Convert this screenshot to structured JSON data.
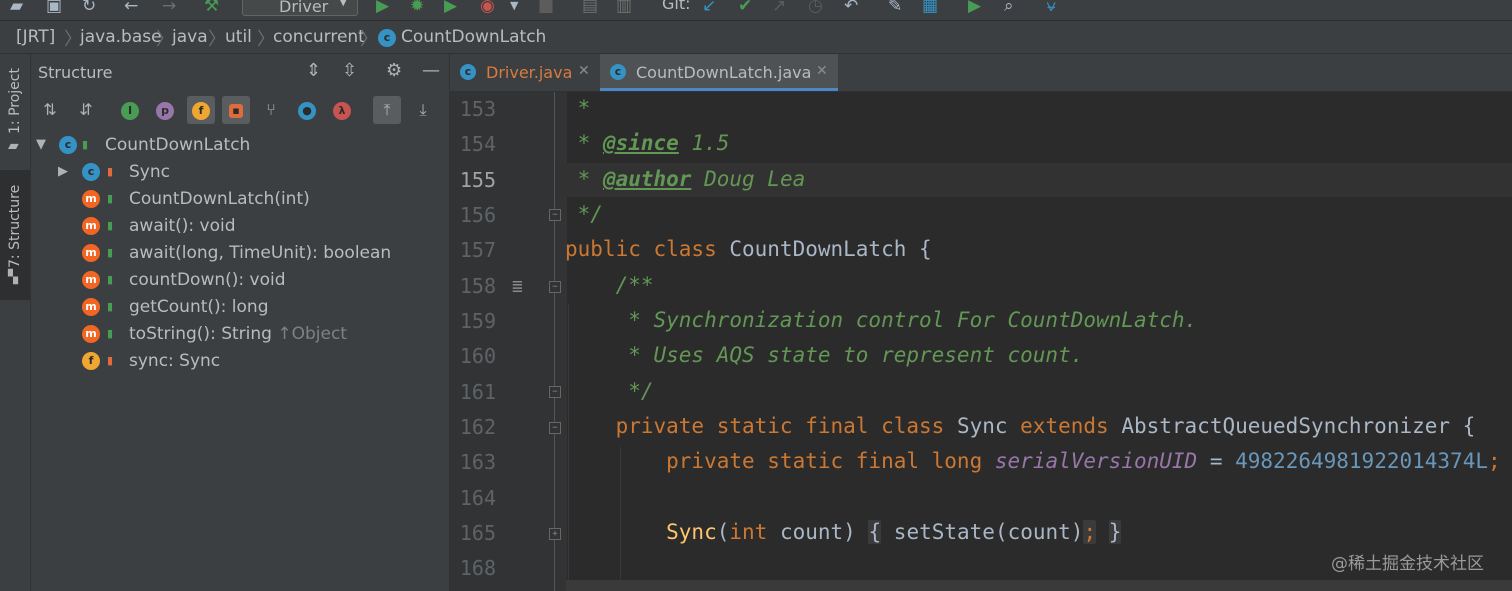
{
  "toolbar": {
    "run_config": "Driver",
    "git_label": "Git:"
  },
  "breadcrumb": [
    "[JRT]",
    "java.base",
    "java",
    "util",
    "concurrent",
    "CountDownLatch"
  ],
  "left_stripe": {
    "project": "1: Project",
    "structure": "7: Structure"
  },
  "structure": {
    "title": "Structure",
    "tree": [
      {
        "label": "CountDownLatch",
        "badge": "c",
        "expanded": true
      },
      {
        "label": "Sync",
        "badge": "c",
        "collapsed": true
      },
      {
        "label": "CountDownLatch(int)",
        "badge": "m"
      },
      {
        "label": "await(): void",
        "badge": "m"
      },
      {
        "label": "await(long, TimeUnit): boolean",
        "badge": "m"
      },
      {
        "label": "countDown(): void",
        "badge": "m"
      },
      {
        "label": "getCount(): long",
        "badge": "m"
      },
      {
        "label": "toString(): String",
        "suffix": "↑Object",
        "badge": "m"
      },
      {
        "label": "sync: Sync",
        "badge": "f"
      }
    ]
  },
  "tabs": [
    {
      "label": "Driver.java",
      "active": false
    },
    {
      "label": "CountDownLatch.java",
      "active": true
    }
  ],
  "editor": {
    "line_numbers": [
      "153",
      "154",
      "155",
      "156",
      "157",
      "158",
      "159",
      "160",
      "161",
      "162",
      "163",
      "164",
      "165",
      "168"
    ],
    "current_line": "155",
    "lines": {
      "l153": " *",
      "l154_star": " * ",
      "l154_tag": "@since",
      "l154_rest": " 1.5",
      "l155_star": " * ",
      "l155_tag": "@author",
      "l155_rest": " Doug Lea",
      "l156": " */",
      "l157_kw": "public class",
      "l157_rest": " CountDownLatch {",
      "l158": "    /**",
      "l159": "     * Synchronization control For CountDownLatch.",
      "l160": "     * Uses AQS state to represent count.",
      "l161": "     */",
      "l162_kw": "    private static final class",
      "l162_mid": " Sync ",
      "l162_ext": "extends",
      "l162_rest": " AbstractQueuedSynchronizer {",
      "l163_kw": "        private static final long",
      "l163_field": "serialVersionUID",
      "l163_eq": " = ",
      "l163_num": "4982264981922014374L",
      "l163_semi": ";",
      "l165_fn": "        Sync",
      "l165_paren": "(",
      "l165_kw": "int",
      "l165_arg": " count)",
      "l165_open": "{",
      "l165_body": "setState(count)",
      "l165_semi": ";",
      "l165_close": "}"
    }
  },
  "watermark": "@稀土掘金技术社区",
  "colors": {
    "keyword": "#cc7832",
    "doc_comment": "#629755",
    "field": "#9876aa",
    "number": "#6897bb",
    "method": "#ffc66d",
    "class_badge": "#3592c4",
    "method_badge": "#f26522",
    "field_badge": "#f0a732"
  }
}
